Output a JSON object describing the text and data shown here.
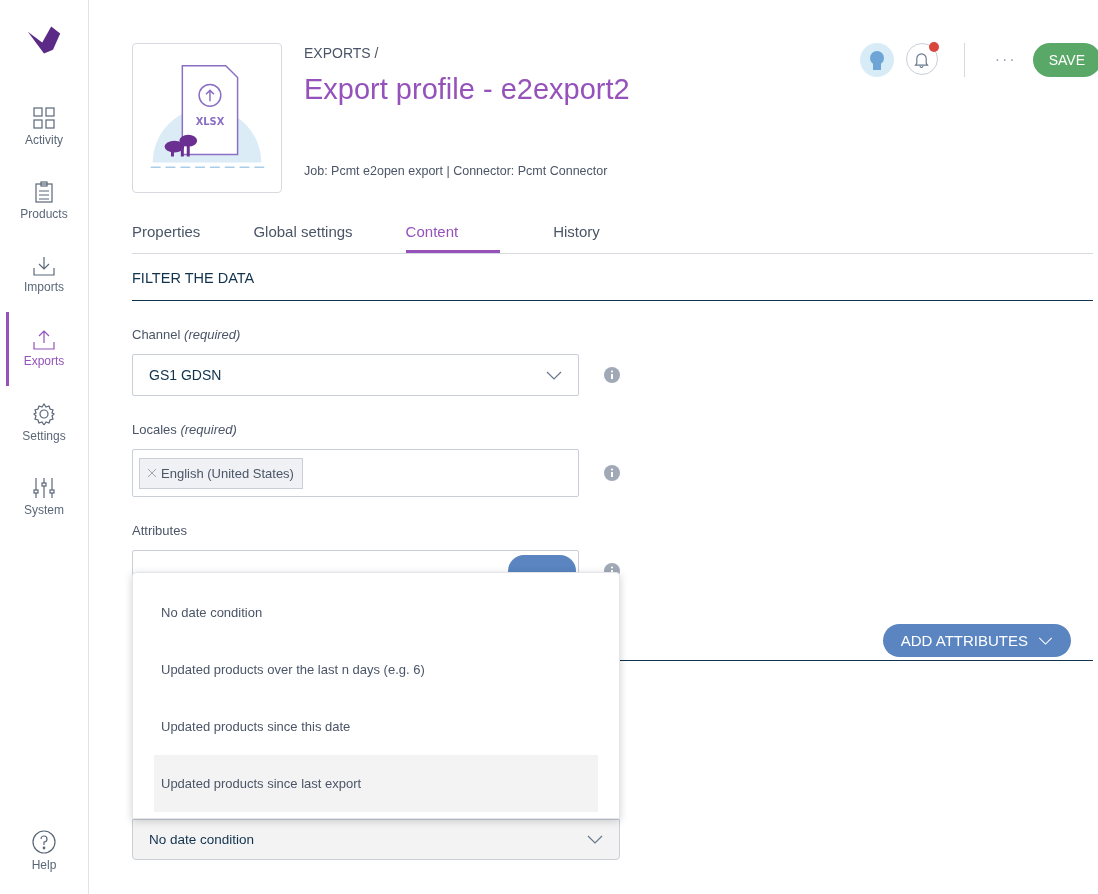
{
  "sidebar": {
    "items": [
      {
        "label": "Activity",
        "kind": "grid",
        "selected": false
      },
      {
        "label": "Products",
        "kind": "clipboard",
        "selected": false
      },
      {
        "label": "Imports",
        "kind": "import",
        "selected": false
      },
      {
        "label": "Exports",
        "kind": "export",
        "selected": true
      },
      {
        "label": "Settings",
        "kind": "gear",
        "selected": false
      },
      {
        "label": "System",
        "kind": "sliders",
        "selected": false
      }
    ],
    "help": "Help"
  },
  "header": {
    "illustration_label": "XLSX",
    "breadcrumb": "EXPORTS /",
    "title": "Export profile - e2export2",
    "subtitle": "Job: Pcmt e2open export | Connector: Pcmt Connector",
    "has_notification": true,
    "more": "···",
    "save": "SAVE"
  },
  "tabs": [
    {
      "label": "Properties",
      "selected": false
    },
    {
      "label": "Global settings",
      "selected": false
    },
    {
      "label": "Content",
      "selected": true
    },
    {
      "label": "History",
      "selected": false
    }
  ],
  "section_title": "FILTER THE DATA",
  "channel": {
    "label": "Channel *(required)*",
    "value": "GS1 GDSN"
  },
  "locales": {
    "label": "Locales *(required)*",
    "chips": [
      "English (United States)"
    ]
  },
  "attributes": {
    "label": "Attributes"
  },
  "add_attributes": "ADD ATTRIBUTES",
  "date_filter": {
    "options": [
      {
        "label": "No date condition",
        "highlighted": false
      },
      {
        "label": "Updated products over the last n days (e.g. 6)",
        "highlighted": false
      },
      {
        "label": "Updated products since this date",
        "highlighted": false
      },
      {
        "label": "Updated products since last export",
        "highlighted": true
      }
    ],
    "value": "No date condition"
  }
}
